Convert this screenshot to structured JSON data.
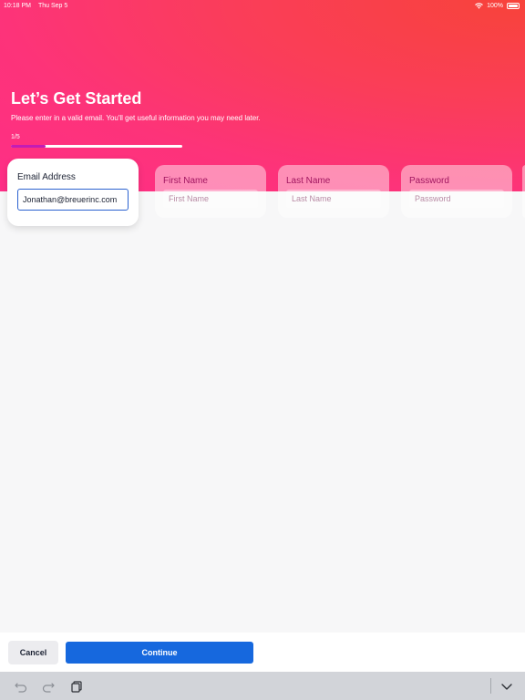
{
  "status_bar": {
    "time": "10:18 PM",
    "date": "Thu Sep 5",
    "battery": "100%",
    "icons": [
      "wifi-icon",
      "battery-icon"
    ]
  },
  "header": {
    "title": "Let’s Get Started",
    "subtitle": "Please enter in a valid email. You'll get useful information you may need later.",
    "step": "1/5",
    "progress": 0.2
  },
  "fields": {
    "email": {
      "label": "Email Address",
      "value": "Jonathan@breuerinc.com"
    },
    "first_name": {
      "label": "First Name",
      "placeholder": "First Name"
    },
    "last_name": {
      "label": "Last Name",
      "placeholder": "Last Name"
    },
    "password": {
      "label": "Password",
      "placeholder": "Password"
    }
  },
  "footer": {
    "cancel_label": "Cancel",
    "continue_label": "Continue"
  },
  "keyboard_bar": {
    "icons": [
      "undo-icon",
      "redo-icon",
      "paste-icon",
      "chevron-down-icon"
    ]
  },
  "colors": {
    "accent": "#1668de",
    "progress_fill": "#c31cb6",
    "gradient_start": "#ff2e87",
    "gradient_end": "#f8433a"
  }
}
